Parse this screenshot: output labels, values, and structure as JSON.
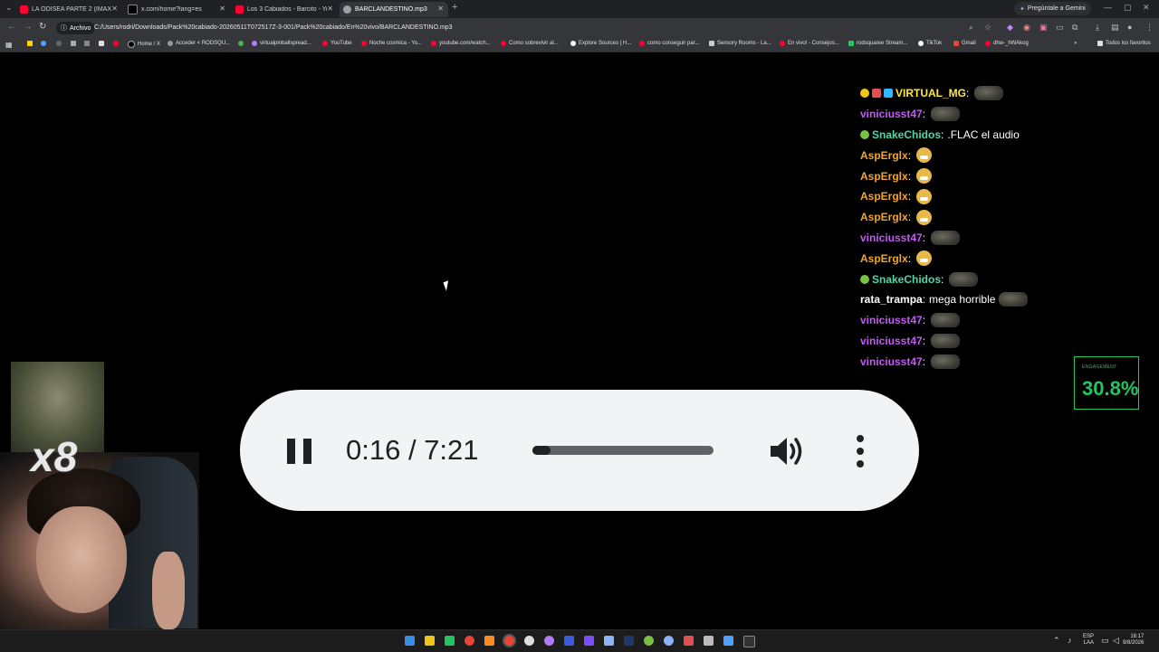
{
  "browser": {
    "tabs": [
      {
        "label": "LA ODISEA PARTE 2 (IMAX) - Yo",
        "color": "#ff0033"
      },
      {
        "label": "x.com/home?lang=es",
        "color": "#000000"
      },
      {
        "label": "Los 3 Cabiados - Barcito - YouT",
        "color": "#ff0033"
      },
      {
        "label": "BARCLANDESTINO.mp3",
        "color": "#9aa0a6"
      }
    ],
    "gemini_label": "Pregúntale a Gemini",
    "archivo_label": "Archivo",
    "url": "C:/Users/rodri/Downloads/Pack%20cabiado-20260511T072517Z-3-001/Pack%20cabiado/En%20vivo/BARCLANDESTINO.mp3",
    "bookmarks": [
      "Home / X",
      "Acceder < RODSQU...",
      "virtualpinballspread...",
      "YouTube",
      "Noche cosmica - Yo...",
      "youtube.com/watch...",
      "Como sobrevivir al...",
      "Explore Sources | H...",
      "como conseguir par...",
      "Sensory Rooms - La...",
      "En vivo! - Consejos...",
      "rodsquaree Stream...",
      "TikTok",
      "Gmail",
      "dhw-_hWAkog"
    ],
    "all_bookmarks": "Todos los favoritos"
  },
  "chat": {
    "messages": [
      {
        "user": "VIRTUAL_MG",
        "color": "#ffe93b",
        "text": "",
        "emote": "emote"
      },
      {
        "user": "viniciusst47",
        "color": "#c259f2",
        "text": "",
        "emote": "emote"
      },
      {
        "user": "SnakeChidos",
        "color": "#4fd8a5",
        "text": ".FLAC el audio",
        "emote": ""
      },
      {
        "user": "AspErglx",
        "color": "#f0a52c",
        "text": "",
        "emote": "emoji"
      },
      {
        "user": "AspErglx",
        "color": "#f0a52c",
        "text": "",
        "emote": "emoji"
      },
      {
        "user": "AspErglx",
        "color": "#f0a52c",
        "text": "",
        "emote": "emoji"
      },
      {
        "user": "AspErglx",
        "color": "#f0a52c",
        "text": "",
        "emote": "emoji"
      },
      {
        "user": "viniciusst47",
        "color": "#c259f2",
        "text": "",
        "emote": "emote"
      },
      {
        "user": "AspErglx",
        "color": "#f0a52c",
        "text": "",
        "emote": "emoji"
      },
      {
        "user": "SnakeChidos",
        "color": "#4fd8a5",
        "text": "",
        "emote": "emote"
      },
      {
        "user": "rata_trampa",
        "color": "#ffffff",
        "text": "mega horrible",
        "emote": "emote"
      },
      {
        "user": "viniciusst47",
        "color": "#c259f2",
        "text": "",
        "emote": "emote"
      },
      {
        "user": "viniciusst47",
        "color": "#c259f2",
        "text": "",
        "emote": "emote"
      },
      {
        "user": "viniciusst47",
        "color": "#c259f2",
        "text": "",
        "emote": "emote"
      }
    ]
  },
  "engagement": {
    "label": "ENGAGEMENT",
    "value": "30.8%"
  },
  "player": {
    "time": "0:16 / 7:21",
    "progress": 0.036
  },
  "overlay": {
    "multiplier": "x8"
  },
  "taskbar": {
    "lang_top": "ESP",
    "lang_bottom": "LAA",
    "time": "16:17",
    "date": "9/8/2026"
  }
}
